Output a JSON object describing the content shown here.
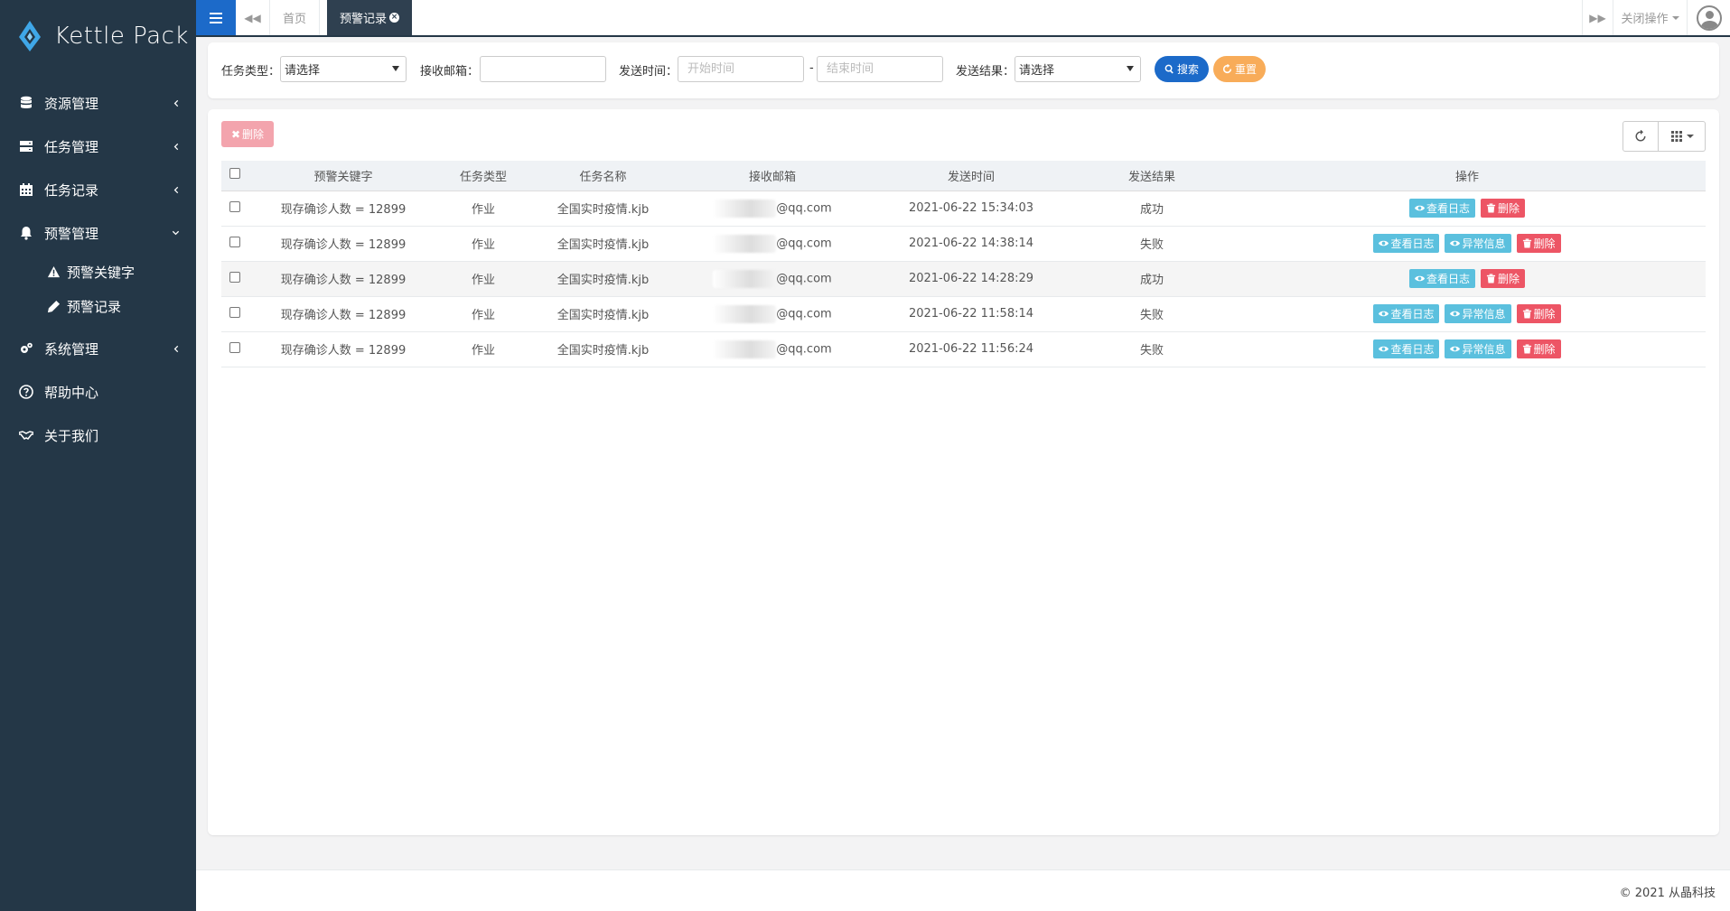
{
  "app": {
    "brand": "Kettle Pack",
    "brand_color": "#1c6ac9",
    "sidebar_color": "#243747"
  },
  "sidebar": {
    "items": [
      {
        "label": "资源管理",
        "icon": "database-icon"
      },
      {
        "label": "任务管理",
        "icon": "server-icon"
      },
      {
        "label": "任务记录",
        "icon": "calendar-icon"
      },
      {
        "label": "预警管理",
        "icon": "bell-icon"
      },
      {
        "label": "系统管理",
        "icon": "gears-icon"
      },
      {
        "label": "帮助中心",
        "icon": "question-circle-icon"
      },
      {
        "label": "关于我们",
        "icon": "handshake-icon"
      }
    ],
    "subitems": [
      {
        "label": "预警关键字",
        "icon": "warning-icon"
      },
      {
        "label": "预警记录",
        "icon": "pencil-icon"
      }
    ]
  },
  "topbar": {
    "tab_home": "首页",
    "tab_active": "预警记录",
    "close_ops": "关闭操作"
  },
  "search": {
    "task_type_label": "任务类型：",
    "task_type_value": "请选择",
    "email_label": "接收邮箱：",
    "email_value": "",
    "send_time_label": "发送时间：",
    "start_placeholder": "开始时间",
    "end_placeholder": "结束时间",
    "range_sep": "-",
    "result_label": "发送结果：",
    "result_value": "请选择",
    "search_btn": "搜索",
    "reset_btn": "重置"
  },
  "toolbar": {
    "delete_label": "删除"
  },
  "table": {
    "columns": [
      "预警关键字",
      "任务类型",
      "任务名称",
      "接收邮箱",
      "发送时间",
      "发送结果",
      "操作"
    ],
    "rows": [
      {
        "keyword": "现存确诊人数 = 12899",
        "type": "作业",
        "name": "全国实时疫情.kjb",
        "email": "@qq.com",
        "time": "2021-06-22 15:34:03",
        "result": "成功",
        "has_error_info": false
      },
      {
        "keyword": "现存确诊人数 = 12899",
        "type": "作业",
        "name": "全国实时疫情.kjb",
        "email": "@qq.com",
        "time": "2021-06-22 14:38:14",
        "result": "失败",
        "has_error_info": true
      },
      {
        "keyword": "现存确诊人数 = 12899",
        "type": "作业",
        "name": "全国实时疫情.kjb",
        "email": "@qq.com",
        "time": "2021-06-22 14:28:29",
        "result": "成功",
        "has_error_info": false
      },
      {
        "keyword": "现存确诊人数 = 12899",
        "type": "作业",
        "name": "全国实时疫情.kjb",
        "email": "@qq.com",
        "time": "2021-06-22 11:58:14",
        "result": "失败",
        "has_error_info": true
      },
      {
        "keyword": "现存确诊人数 = 12899",
        "type": "作业",
        "name": "全国实时疫情.kjb",
        "email": "@qq.com",
        "time": "2021-06-22 11:56:24",
        "result": "失败",
        "has_error_info": true
      }
    ],
    "actions": {
      "view_log": "查看日志",
      "error_info": "异常信息",
      "delete": "删除"
    }
  },
  "footer": {
    "copyright": "© 2021 从晶科技"
  }
}
